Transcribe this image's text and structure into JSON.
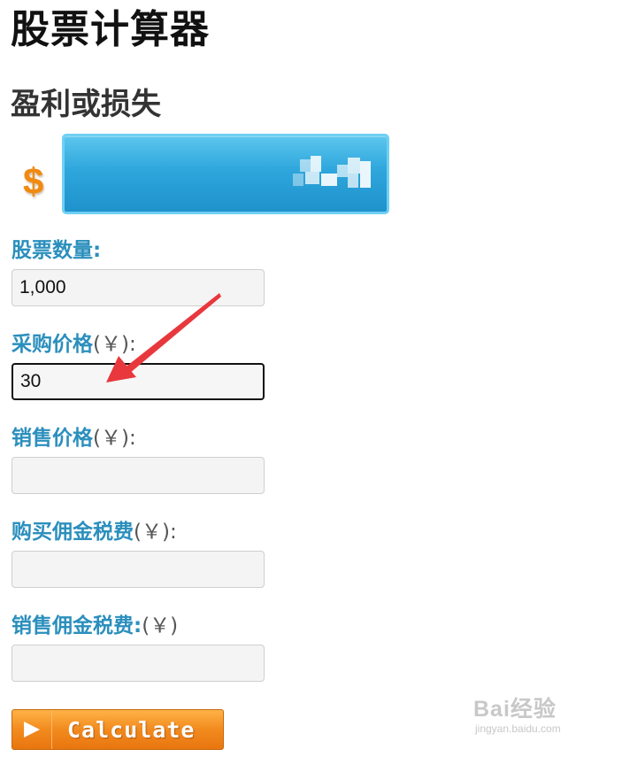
{
  "page": {
    "title": "股票计算器",
    "section_title": "盈利或损失"
  },
  "result": {
    "currency_symbol": "$",
    "value": ""
  },
  "fields": [
    {
      "label": "股票数量:",
      "unit": "",
      "value": "1,000",
      "placeholder": ""
    },
    {
      "label": "采购价格",
      "unit": "(￥):",
      "value": "30",
      "placeholder": ""
    },
    {
      "label": "销售价格",
      "unit": "(￥):",
      "value": "",
      "placeholder": ""
    },
    {
      "label": "购买佣金税费",
      "unit": "(￥):",
      "value": "",
      "placeholder": ""
    },
    {
      "label": "销售佣金税费:",
      "unit": "(￥)",
      "value": "",
      "placeholder": ""
    }
  ],
  "calculate_button": {
    "label": "Calculate"
  },
  "watermark": {
    "logo": "Bai经验",
    "url": "jingyan.baidu.com"
  },
  "colors": {
    "label": "#2b8fbd",
    "result_box": "#2ea6dc",
    "button": "#f28a1e",
    "annotation_arrow": "#e8383d"
  },
  "icons": {
    "button": "play-arrow-icon",
    "annotation": "red-pointer-arrow-icon"
  }
}
